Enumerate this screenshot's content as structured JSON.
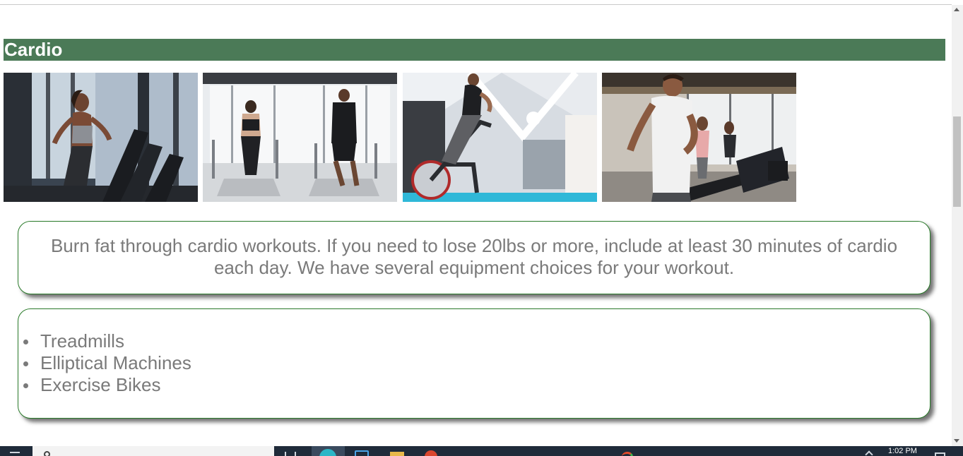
{
  "section": {
    "title": "Cardio"
  },
  "gallery": {
    "images": [
      {
        "name": "treadmill-woman-window-photo"
      },
      {
        "name": "treadmill-couple-window-photo"
      },
      {
        "name": "exercise-bike-loft-gym-photo"
      },
      {
        "name": "treadmill-group-gym-photo"
      }
    ]
  },
  "intro": {
    "text": "Burn fat through cardio workouts. If you need to lose 20lbs or more, include at least 30 minutes of cardio each day. We have several equipment choices for your workout."
  },
  "equipment": {
    "items": [
      "Treadmills",
      "Elliptical Machines",
      "Exercise Bikes"
    ]
  },
  "taskbar": {
    "time": "1:02 PM",
    "icons": [
      "start-icon",
      "search-icon",
      "task-view-icon",
      "edge-browser-icon",
      "app-window-icon",
      "file-explorer-icon",
      "office-icon",
      "chrome-icon",
      "tray-chevron-icon",
      "notification-icon"
    ]
  },
  "colors": {
    "header_bg": "#4b7a57",
    "box_border": "#2a7a2a",
    "body_text": "#7a7a7a",
    "taskbar_bg": "#1f2b3a"
  }
}
